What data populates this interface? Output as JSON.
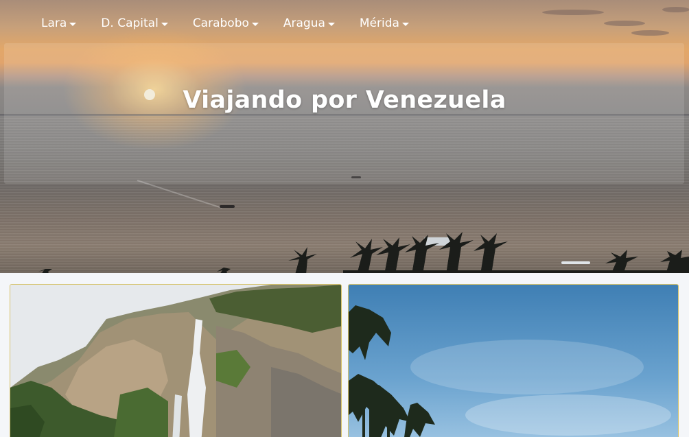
{
  "nav": {
    "items": [
      {
        "label": "Lara"
      },
      {
        "label": "D. Capital"
      },
      {
        "label": "Carabobo"
      },
      {
        "label": "Aragua"
      },
      {
        "label": "Mérida"
      }
    ]
  },
  "hero": {
    "title": "Viajando por Venezuela"
  },
  "cards": [
    {
      "image": "waterfall-cliff-photo"
    },
    {
      "image": "palm-trees-sky-photo"
    }
  ]
}
